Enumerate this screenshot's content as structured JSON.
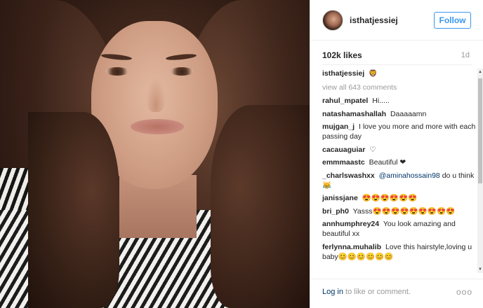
{
  "post": {
    "username": "isthatjessiej",
    "follow_label": "Follow",
    "likes": "102k likes",
    "time": "1d",
    "caption_user": "isthatjessiej",
    "caption_text": "🦁",
    "view_all": "view all 643 comments"
  },
  "comments": [
    {
      "user": "rahul_mpatel",
      "text": "Hi....."
    },
    {
      "user": "natashamashallah",
      "text": "Daaaaamn"
    },
    {
      "user": "mujgan_j",
      "text": "I love you more and more with each passing day"
    },
    {
      "user": "cacauaguiar",
      "text": "♡"
    },
    {
      "user": "emmmaastc",
      "text": "Beautiful ❤"
    },
    {
      "user": "_charlswashxx",
      "mention": "@aminahossain98",
      "text": " do u think 😹"
    },
    {
      "user": "janissjane",
      "text": "😍😍😍😍😍😍"
    },
    {
      "user": "bri_ph0",
      "text": "Yasss😍😍😍😍😍😍😍😍😍"
    },
    {
      "user": "annhumphrey24",
      "text": "You look amazing and beautiful xx"
    },
    {
      "user": "ferlynna.muhalib",
      "text": "Love this hairstyle,loving u baby😊😊😊😊😊😊"
    }
  ],
  "footer": {
    "login_label": "Log in",
    "rest": " to like or comment.",
    "more": "ooo"
  },
  "colors": {
    "accent": "#3897f0",
    "link": "#003569",
    "muted": "#999999"
  }
}
